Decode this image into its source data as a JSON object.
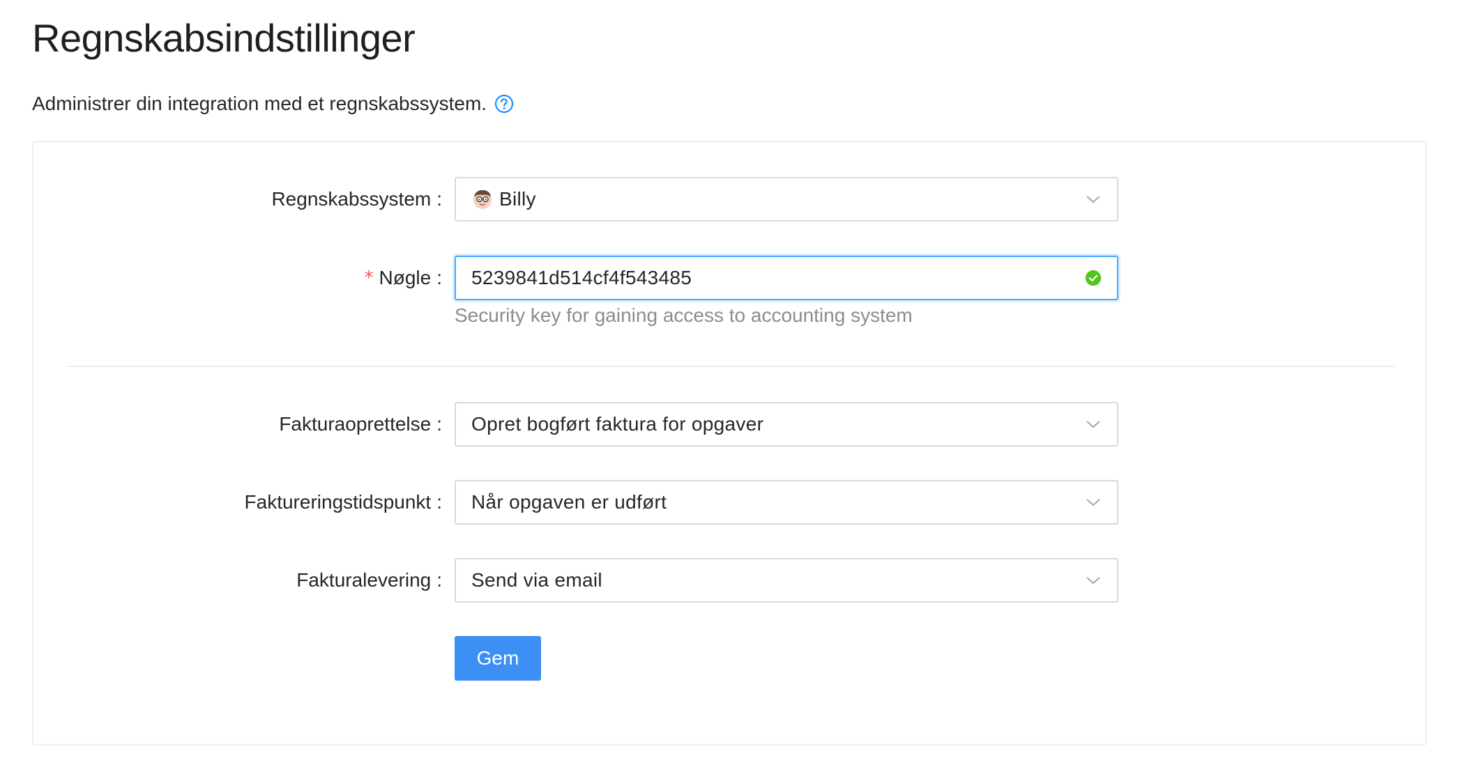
{
  "page": {
    "title": "Regnskabsindstillinger",
    "subtitle": "Administrer din integration med et regnskabssystem."
  },
  "form": {
    "accounting_system": {
      "label": "Regnskabssystem",
      "colon": ":",
      "value": "Billy"
    },
    "key": {
      "required_mark": "*",
      "label": "Nøgle",
      "colon": ":",
      "value": "5239841d514cf4f543485",
      "help": "Security key for gaining access to accounting system",
      "status": "valid"
    },
    "invoice_creation": {
      "label": "Fakturaoprettelse",
      "colon": ":",
      "value": "Opret bogført faktura for opgaver"
    },
    "invoice_timing": {
      "label": "Faktureringstidspunkt",
      "colon": ":",
      "value": "Når opgaven er udført"
    },
    "invoice_delivery": {
      "label": "Fakturalevering",
      "colon": ":",
      "value": "Send via email"
    },
    "save_label": "Gem"
  },
  "icons": {
    "help": "question-circle-icon",
    "chevron": "chevron-down-icon",
    "valid": "check-circle-icon",
    "avatar": "billy-avatar-icon"
  },
  "colors": {
    "primary": "#3b8ff5",
    "focus_border": "#40a9ff",
    "success": "#52c41a",
    "required": "#ff4d4f",
    "help_icon": "#1890ff"
  }
}
